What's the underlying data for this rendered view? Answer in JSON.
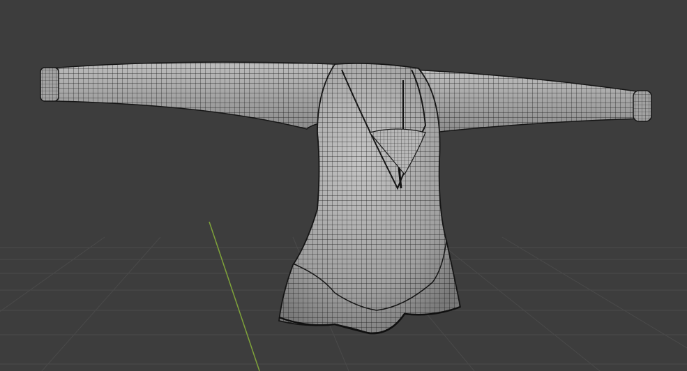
{
  "viewport": {
    "background_color": "#3d3d3d",
    "grid_color": "#4a4a4a",
    "y_axis_color": "#7fa33a",
    "mesh_fill_color": "#a9a9a9",
    "wire_color": "#1a1a1a",
    "view_mode": "wireframe-overlay",
    "object": "garment-mesh"
  }
}
